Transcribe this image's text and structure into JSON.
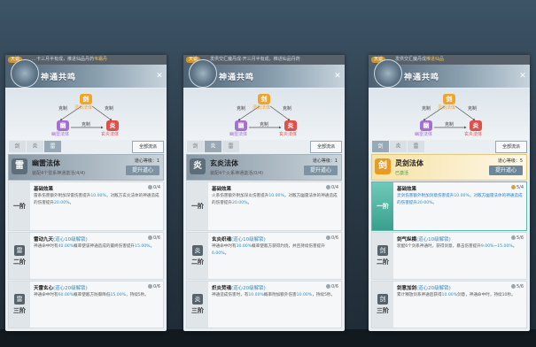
{
  "panels": [
    {
      "ticker": {
        "tag": "天谕",
        "text": "…卡三月半有成，推进仙品丹药",
        "hl": "韦霜丹"
      },
      "title": "神通共鸣",
      "diagram": {
        "top": "剑",
        "top_label": "灵剑法体",
        "left": "幽",
        "left_label": "幽雷法体",
        "right": "炎",
        "right_label": "玄炎法体",
        "edges": [
          "克制",
          "克制",
          "克制"
        ]
      },
      "tabs": [
        "剑",
        "炎",
        "雷"
      ],
      "tab_active": 2,
      "all_btn": "全部流派",
      "law": {
        "icon": "雷",
        "name": "幽雷法体",
        "sub": "装配4个雷系神通激活(4/4)",
        "level": "道心等级：1",
        "upgrade": "提升道心",
        "active": false
      },
      "tiers": [
        {
          "rank": "一阶",
          "name": "基础效果",
          "req": "",
          "count": "0/4",
          "desc": "雷系伤害额外附加深雷伤害提升",
          "v1": "10.00%",
          "desc2": "，对敌方玄炎法体的神通造成的伤害提升",
          "v2": "20.00%",
          "desc3": "。"
        },
        {
          "rank": "二阶",
          "name": "雷动九天",
          "req": "(道心10级解锁)",
          "count": "0/6",
          "desc": "神通命中时有",
          "v1": "40.00%",
          "desc2": "概率使该神通造成的最终伤害提升",
          "v2": "15.00%",
          "desc3": "。"
        },
        {
          "rank": "三阶",
          "name": "天雷玄心",
          "req": "(道心20级解锁)",
          "count": "0/6",
          "desc": "神通命中时有",
          "v1": "60.00%",
          "desc2": "概率使敌方防御降低",
          "v2": "15.00%",
          "desc3": "，持续5秒。"
        }
      ]
    },
    {
      "ticker": {
        "tag": "天谕",
        "text": "发供交汇魔丹成·开三月半有成，推进仙品丹药",
        "hl": ""
      },
      "title": "神通共鸣",
      "diagram": {
        "top": "剑",
        "top_label": "灵剑法体",
        "left": "幽",
        "left_label": "幽雷法体",
        "right": "炎",
        "right_label": "玄炎法体",
        "edges": [
          "克制",
          "克制",
          "克制"
        ]
      },
      "tabs": [
        "剑",
        "炎",
        "雷"
      ],
      "tab_active": 1,
      "all_btn": "全部流派",
      "law": {
        "icon": "炎",
        "name": "玄炎法体",
        "sub": "装配4个火系神通激活(0/4)",
        "level": "道心等级：1",
        "upgrade": "提升道心",
        "active": false
      },
      "tiers": [
        {
          "rank": "一阶",
          "name": "基础效果",
          "req": "",
          "count": "0/4",
          "desc": "火系伤害额外附加深炎伤害提升",
          "v1": "10.00%",
          "desc2": "，对敌方幽雷法体的神通造成的伤害提升",
          "v2": "20.00%",
          "desc3": "。"
        },
        {
          "rank": "二阶",
          "name": "玄炎织魂",
          "req": "(道心10级解锁)",
          "count": "0/6",
          "desc": "神通命中时有",
          "v1": "30.00%",
          "desc2": "概率使敌方获得灼烧，并且持续伤害提升",
          "v2": "6.00%",
          "desc3": "。"
        },
        {
          "rank": "三阶",
          "name": "炽炎焚魂",
          "req": "(道心20级解锁)",
          "count": "0/6",
          "desc": "神通造成伤害时，有",
          "v1": "10.00%",
          "desc2": "概率附加额外伤害",
          "v2": "10.00%",
          "desc3": "，持续5秒。"
        }
      ]
    },
    {
      "ticker": {
        "tag": "天谕",
        "text": "发供交汇魔丹成",
        "hl": "推进仙品"
      },
      "title": "神通共鸣",
      "diagram": {
        "top": "剑",
        "top_label": "灵剑法体",
        "left": "幽",
        "left_label": "幽雷法体",
        "right": "炎",
        "right_label": "玄炎法体",
        "edges": [
          "克制",
          "克制",
          "克制"
        ]
      },
      "tabs": [
        "剑",
        "炎",
        "雷"
      ],
      "tab_active": 0,
      "all_btn": "全部流派",
      "law": {
        "icon": "剑",
        "name": "灵剑法体",
        "sub": "已激活",
        "level": "道心等级：5",
        "upgrade": "提升道心",
        "active": true
      },
      "tiers": [
        {
          "rank": "一阶",
          "name": "基础效果",
          "req": "",
          "count": "5/4",
          "desc": "灵剑伤害额外附加剑意伤害提升",
          "v1": "10.00%",
          "desc2": "，对敌方幽雷法体的神通造成的伤害提升",
          "v2": "20.00%",
          "desc3": "。",
          "active": true
        },
        {
          "rank": "二阶",
          "name": "剑气纵横",
          "req": "(道心10级解锁)",
          "count": "5/6",
          "desc": "装配6个剑系神通时，获得剑意，暴击伤害提升",
          "v1": "9.00%~15.00%",
          "desc2": "",
          "v2": "",
          "desc3": "。"
        },
        {
          "rank": "三阶",
          "name": "剑意加剑",
          "req": "(道心20级解锁)",
          "count": "5/6",
          "desc": "累计释放剑系神通后获得",
          "v1": "10.00%",
          "desc2": "剑意，神通命中时",
          "v2": "",
          "desc3": "，持续10秒。"
        }
      ]
    }
  ],
  "colors": {
    "sword": "#f0a52a",
    "thunder": "#a56fd0",
    "flame": "#e0504a",
    "accent": "#3a9f8e"
  }
}
